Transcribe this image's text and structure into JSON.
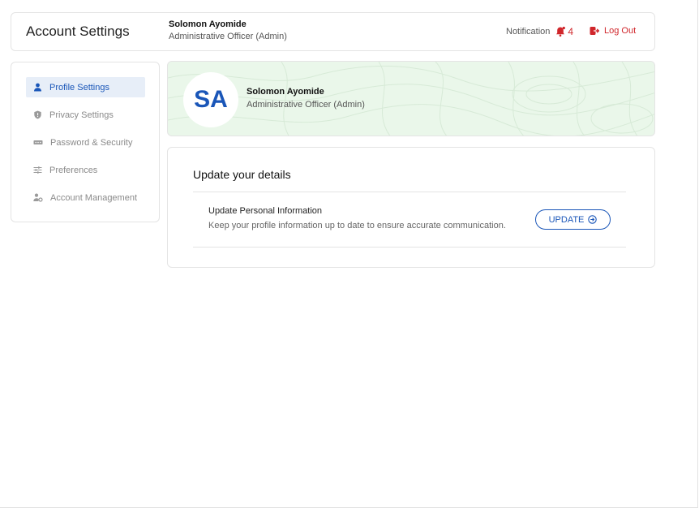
{
  "header": {
    "title": "Account Settings",
    "user_name": "Solomon Ayomide",
    "user_role": "Administrative Officer (Admin)",
    "notification_label": "Notification",
    "notification_count": "4",
    "logout_label": "Log Out"
  },
  "sidebar": {
    "items": [
      {
        "label": "Profile Settings",
        "icon": "user-icon",
        "active": true
      },
      {
        "label": "Privacy Settings",
        "icon": "shield-icon",
        "active": false
      },
      {
        "label": "Password & Security",
        "icon": "password-icon",
        "active": false
      },
      {
        "label": "Preferences",
        "icon": "sliders-icon",
        "active": false
      },
      {
        "label": "Account Management",
        "icon": "account-manage-icon",
        "active": false
      }
    ]
  },
  "profile": {
    "initials": "SA",
    "name": "Solomon Ayomide",
    "role": "Administrative Officer (Admin)"
  },
  "details": {
    "title": "Update your details",
    "item_title": "Update Personal Information",
    "item_description": "Keep your profile information up to date to ensure accurate communication.",
    "button_label": "UPDATE"
  },
  "colors": {
    "accent": "#1a56b8",
    "danger": "#d0262b",
    "banner_bg": "#eaf7ea",
    "active_bg": "#e7eef8"
  }
}
